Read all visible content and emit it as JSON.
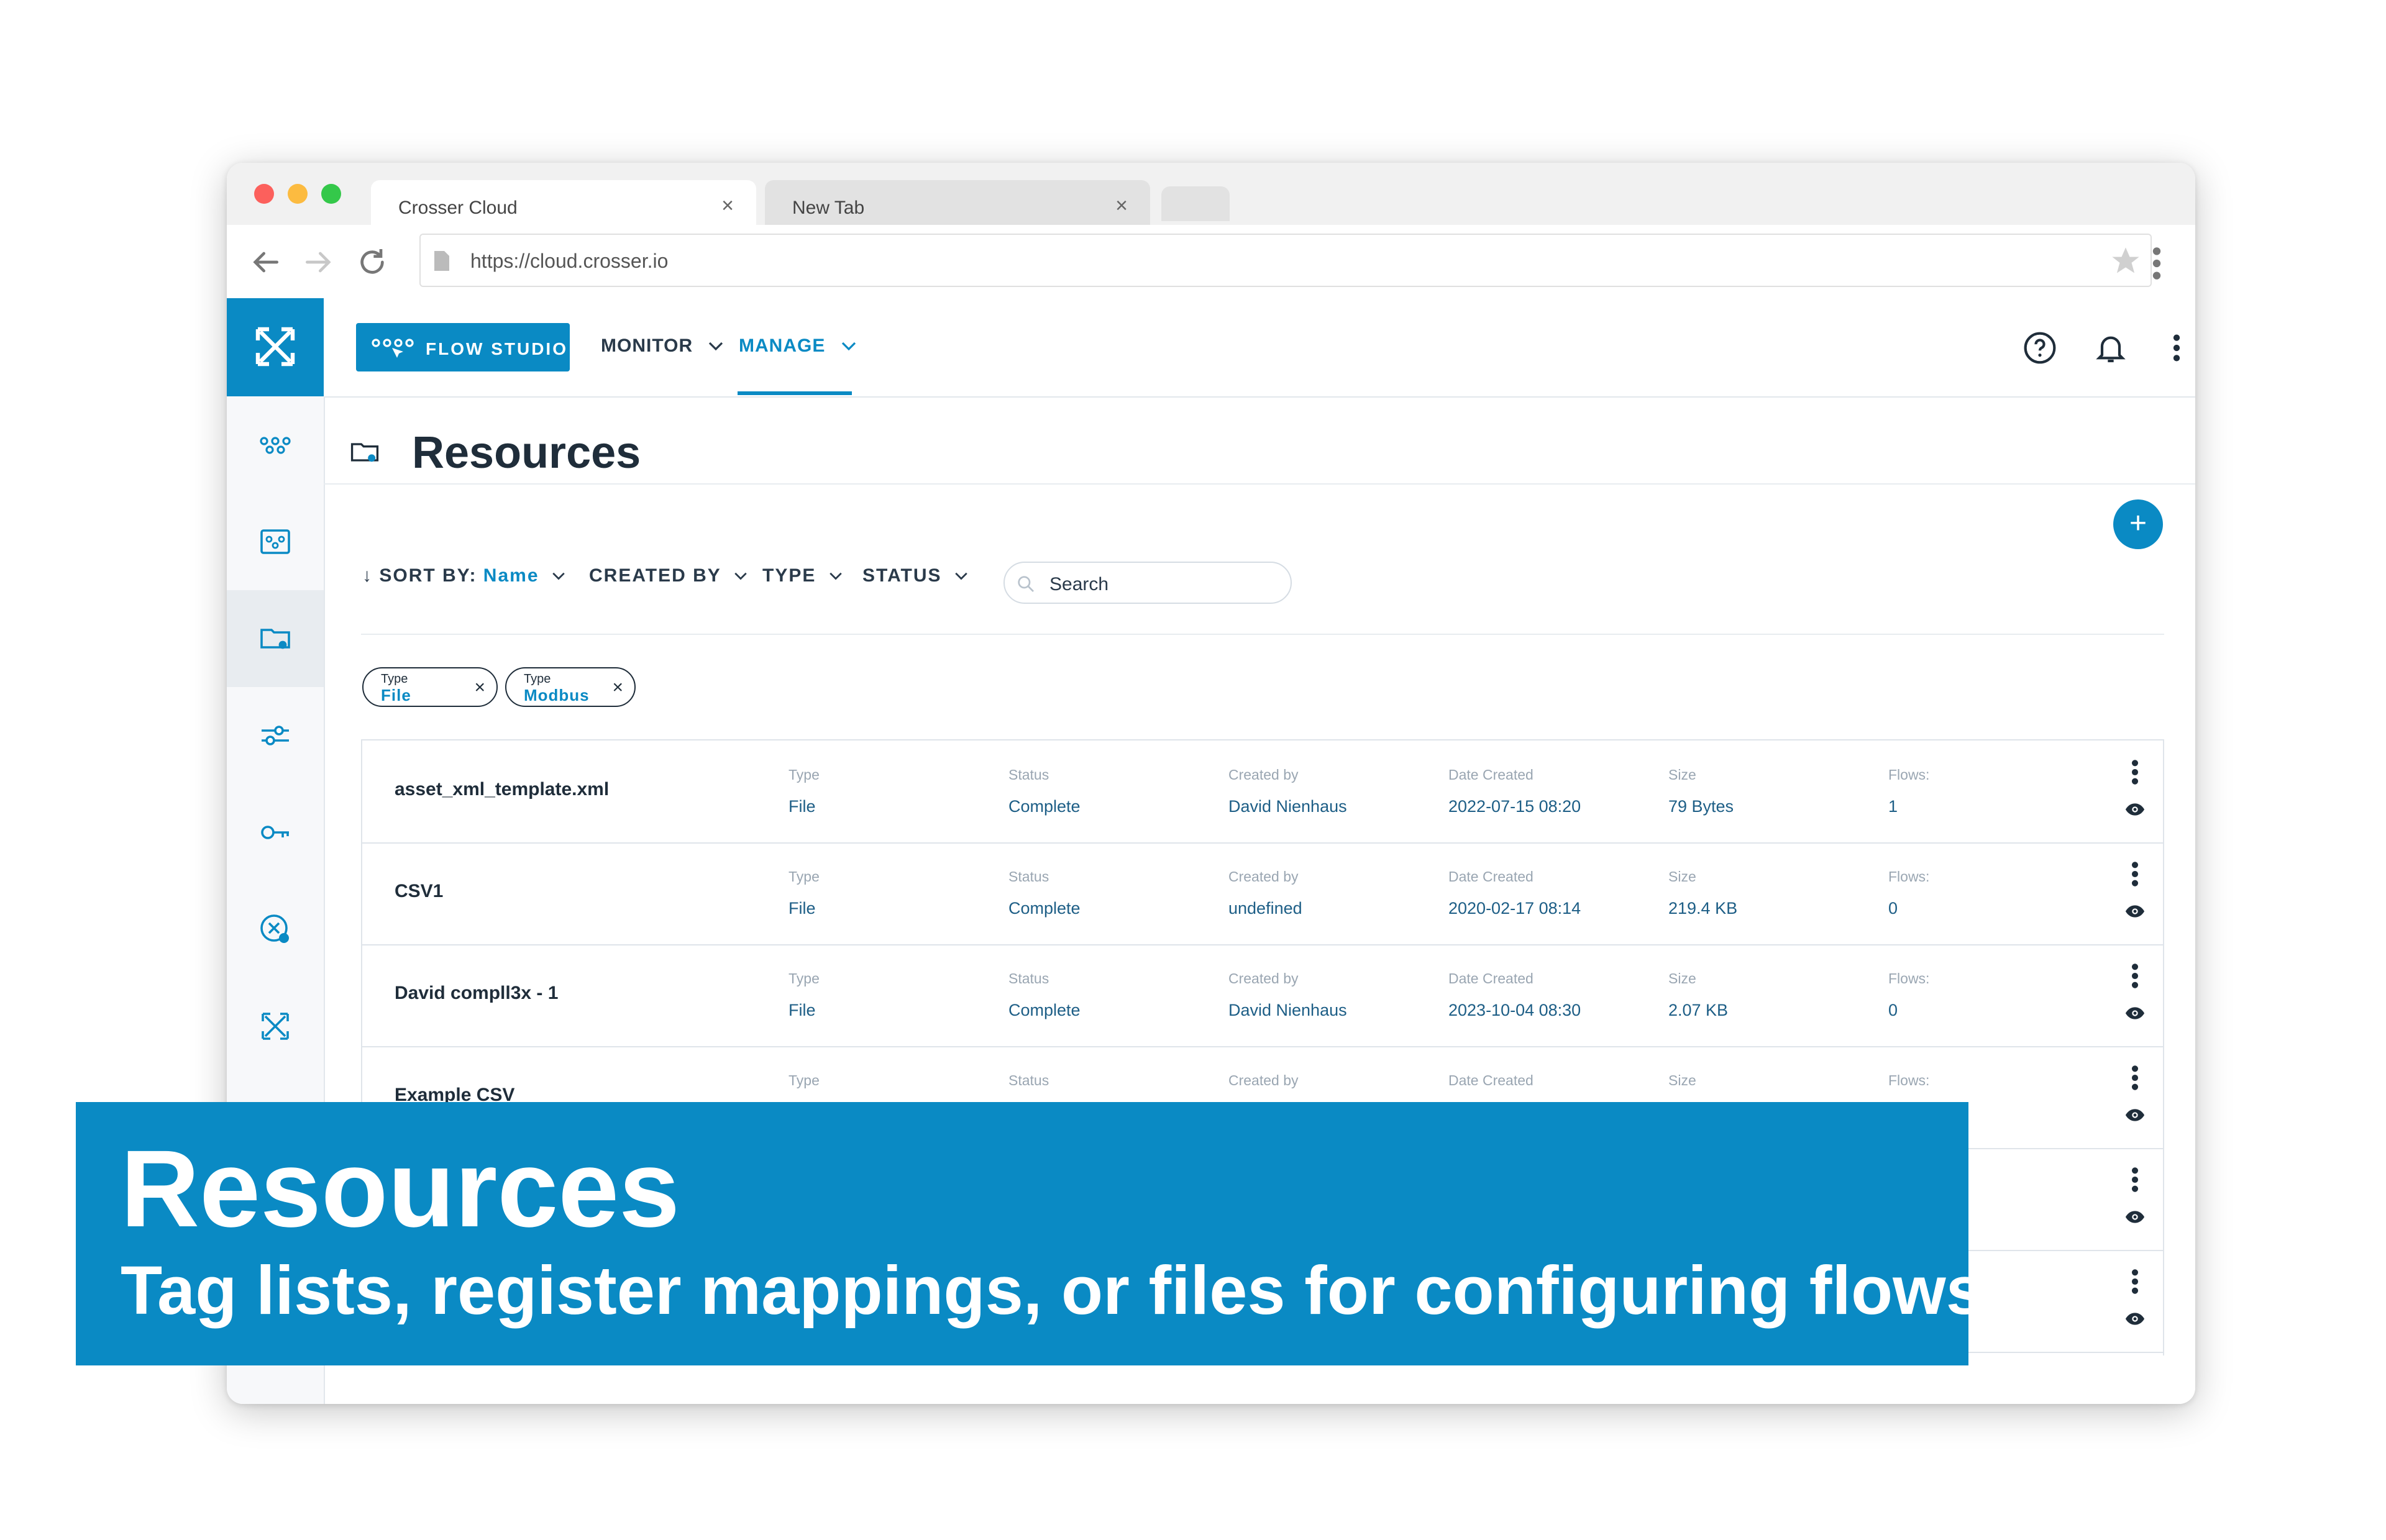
{
  "browser": {
    "tabs": [
      {
        "label": "Crosser Cloud",
        "active": true
      },
      {
        "label": "New Tab",
        "active": false
      }
    ],
    "url": "https://cloud.crosser.io"
  },
  "topnav": {
    "flow_studio": "FLOW STUDIO",
    "monitor": "MONITOR",
    "manage": "MANAGE"
  },
  "page": {
    "title": "Resources"
  },
  "filters": {
    "sort_label": "SORT BY:",
    "sort_value": "Name",
    "created_by": "CREATED BY",
    "type": "TYPE",
    "status": "STATUS",
    "search_placeholder": "Search"
  },
  "chips": [
    {
      "key": "Type",
      "value": "File"
    },
    {
      "key": "Type",
      "value": "Modbus"
    }
  ],
  "columns": {
    "type": "Type",
    "status": "Status",
    "created_by": "Created by",
    "date_created": "Date Created",
    "size": "Size",
    "flows": "Flows:"
  },
  "rows": [
    {
      "name": "asset_xml_template.xml",
      "type": "File",
      "status": "Complete",
      "created_by": "David Nienhaus",
      "date_created": "2022-07-15 08:20",
      "size": "79 Bytes",
      "flows": "1"
    },
    {
      "name": "CSV1",
      "type": "File",
      "status": "Complete",
      "created_by": "undefined",
      "date_created": "2020-02-17 08:14",
      "size": "219.4 KB",
      "flows": "0"
    },
    {
      "name": "David compll3x - 1",
      "type": "File",
      "status": "Complete",
      "created_by": "David Nienhaus",
      "date_created": "2023-10-04 08:30",
      "size": "2.07 KB",
      "flows": "0"
    },
    {
      "name": "Example CSV",
      "type": "",
      "status": "",
      "created_by": "",
      "date_created": "",
      "size": "",
      "flows": ""
    }
  ],
  "banner": {
    "heading": "Resources",
    "subheading": "Tag lists, register mappings, or files for configuring flows"
  },
  "colors": {
    "accent": "#0a8ac4",
    "text_dark": "#1f2d3a",
    "value_text": "#1d5e86"
  }
}
